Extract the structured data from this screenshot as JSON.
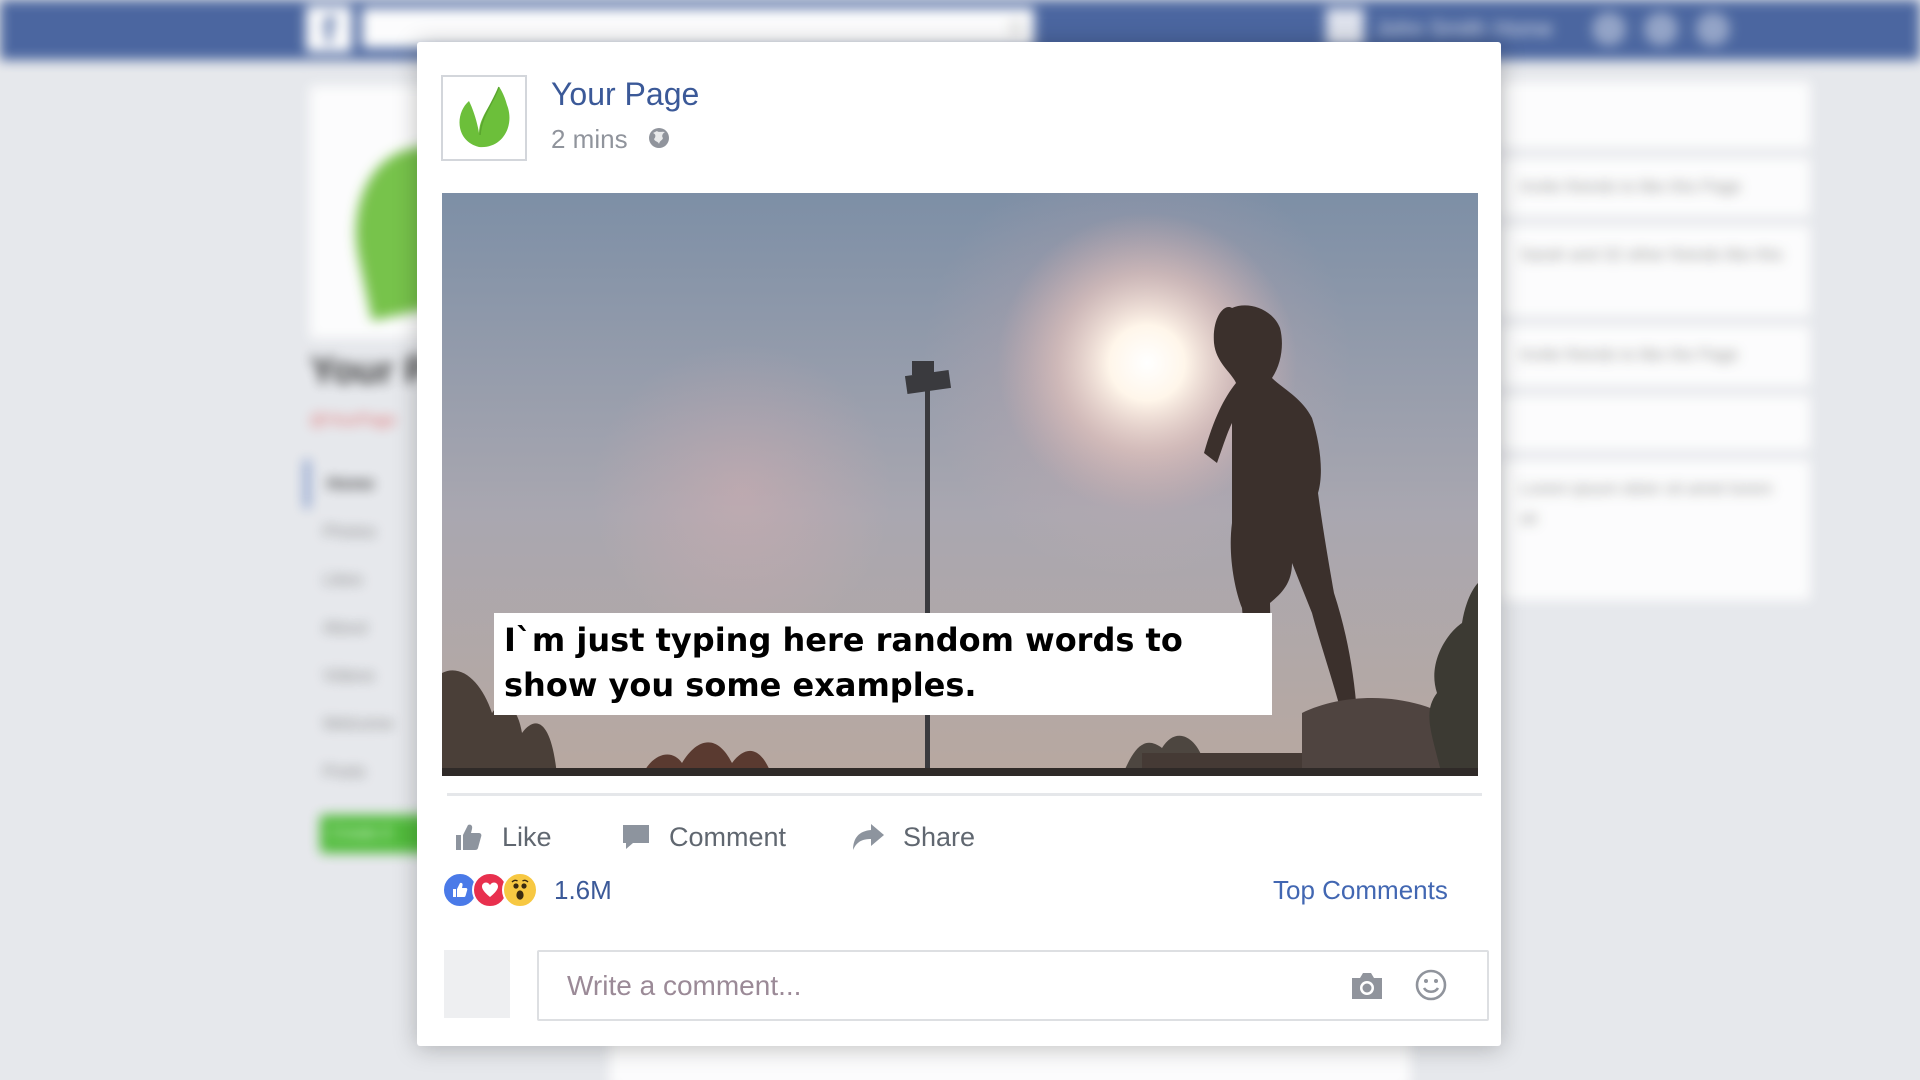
{
  "background": {
    "search_icon": "search-icon",
    "top_user_name": "John Smith",
    "top_home": "Home",
    "page_name": "Your P",
    "page_handle": "@YourPage",
    "nav": [
      "Home",
      "Photos",
      "Likes",
      "About",
      "Videos",
      "Welcome",
      "Posts"
    ],
    "create_label": "Create A",
    "right_boxes": [
      "",
      "Invite friends to like this Page",
      "Sarah and 32 other friends like this",
      "Invite friends to like the Page",
      "",
      "Lorem ipsum dolor sit amet lorem sit"
    ]
  },
  "post": {
    "page_name": "Your Page",
    "time": "2 mins",
    "privacy_icon": "globe-icon",
    "caption": "I`m just typing here random words to show you some examples.",
    "actions": {
      "like": "Like",
      "comment": "Comment",
      "share": "Share"
    },
    "reactions": [
      "like",
      "love",
      "wow"
    ],
    "reaction_count": "1.6M",
    "top_comments": "Top Comments",
    "comment_placeholder": "Write a comment..."
  },
  "colors": {
    "brand": "#3b5998",
    "link": "#4267b2",
    "leaf": "#6cbf3a"
  }
}
